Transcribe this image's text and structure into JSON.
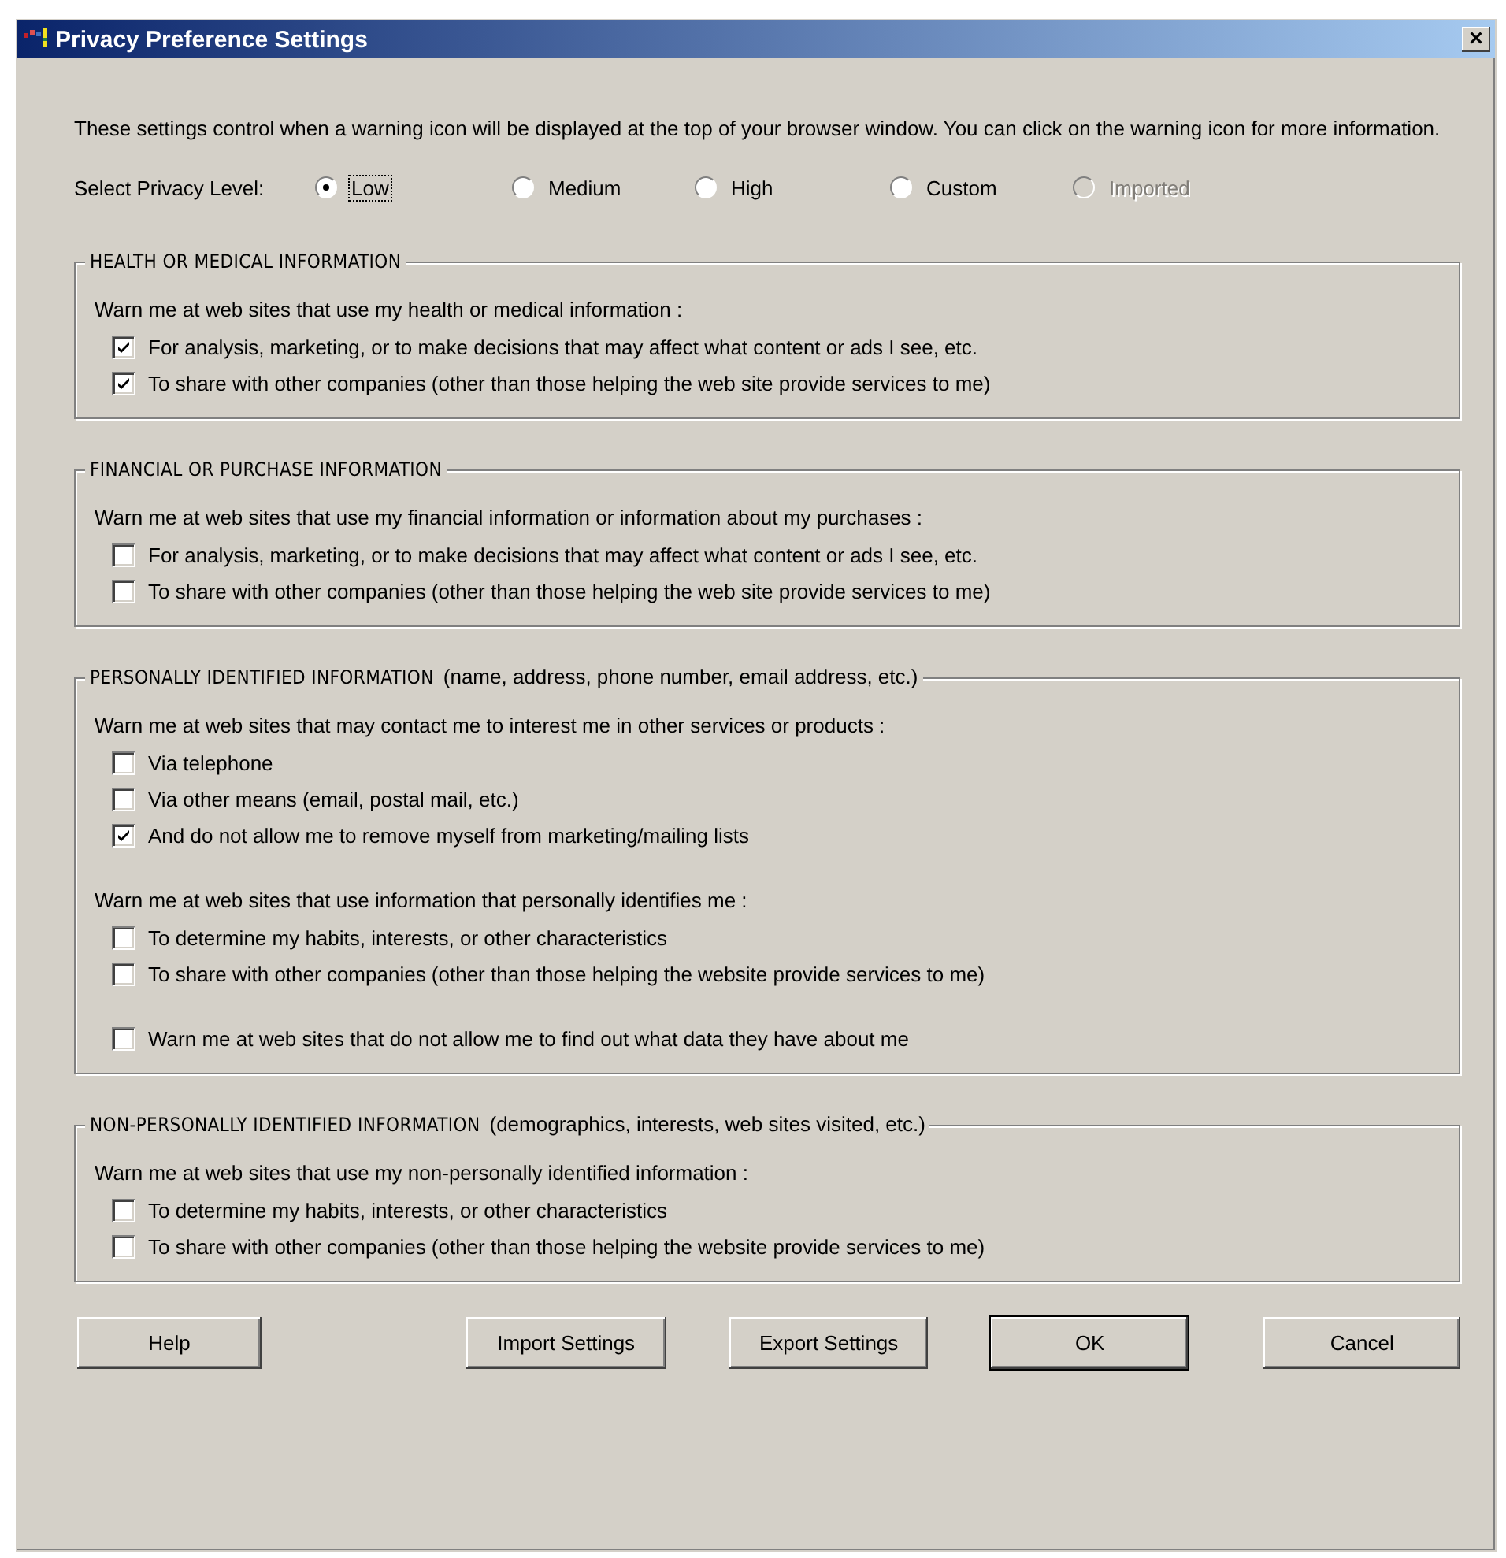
{
  "window": {
    "title": "Privacy Preference Settings",
    "close": "×"
  },
  "intro": "These settings control when a warning icon will be displayed at the top of your browser window.  You can click on the warning icon for more information.",
  "privacy_level": {
    "label": "Select Privacy Level:",
    "options": [
      {
        "label": "Low",
        "selected": true,
        "disabled": false
      },
      {
        "label": "Medium",
        "selected": false,
        "disabled": false
      },
      {
        "label": "High",
        "selected": false,
        "disabled": false
      },
      {
        "label": "Custom",
        "selected": false,
        "disabled": false
      },
      {
        "label": "Imported",
        "selected": false,
        "disabled": true
      }
    ]
  },
  "groups": [
    {
      "title": "HEALTH OR MEDICAL INFORMATION",
      "blocks": [
        {
          "label": "Warn me at web sites that use my health or medical information :",
          "options": [
            {
              "label": "For analysis, marketing, or to make decisions that may affect what content or ads I see, etc.",
              "checked": true
            },
            {
              "label": "To share with other companies (other than those helping the web site provide services to me)",
              "checked": true
            }
          ]
        }
      ]
    },
    {
      "title": "FINANCIAL OR PURCHASE INFORMATION",
      "blocks": [
        {
          "label": "Warn me at web sites that use my financial information or information about my purchases :",
          "options": [
            {
              "label": "For analysis, marketing, or to make decisions that may affect what content or ads I see, etc.",
              "checked": false
            },
            {
              "label": "To share with other companies (other than those helping the web site provide services to me)",
              "checked": false
            }
          ]
        }
      ]
    },
    {
      "title": "PERSONALLY IDENTIFIED INFORMATION",
      "note": "(name, address, phone number, email address, etc.)",
      "blocks": [
        {
          "label": "Warn me at web sites that may contact me to interest me in other services or products :",
          "options": [
            {
              "label": "Via telephone",
              "checked": false
            },
            {
              "label": "Via other means (email, postal mail, etc.)",
              "checked": false
            },
            {
              "label": "And do not allow me to remove myself from marketing/mailing lists",
              "checked": true
            }
          ]
        },
        {
          "label": "Warn me at web sites that use information that personally identifies me :",
          "options": [
            {
              "label": "To determine my habits, interests, or other characteristics",
              "checked": false
            },
            {
              "label": "To share with other companies (other than those helping the website provide services to me)",
              "checked": false
            }
          ]
        },
        {
          "options": [
            {
              "label": "Warn me at web sites that do not allow me to find out what data they have about me",
              "checked": false
            }
          ]
        }
      ]
    },
    {
      "title": "NON-PERSONALLY IDENTIFIED INFORMATION",
      "note": "(demographics, interests, web sites visited, etc.)",
      "blocks": [
        {
          "label": "Warn me at web sites that use my non-personally identified information :",
          "options": [
            {
              "label": "To determine my habits, interests, or other characteristics",
              "checked": false
            },
            {
              "label": "To share with other companies (other than those helping the website provide services to me)",
              "checked": false
            }
          ]
        }
      ]
    }
  ],
  "buttons": [
    {
      "label": "Help",
      "default": false
    },
    {
      "label": "Import Settings",
      "default": false
    },
    {
      "label": "Export Settings",
      "default": false
    },
    {
      "label": "OK",
      "default": true
    },
    {
      "label": "Cancel",
      "default": false
    }
  ]
}
